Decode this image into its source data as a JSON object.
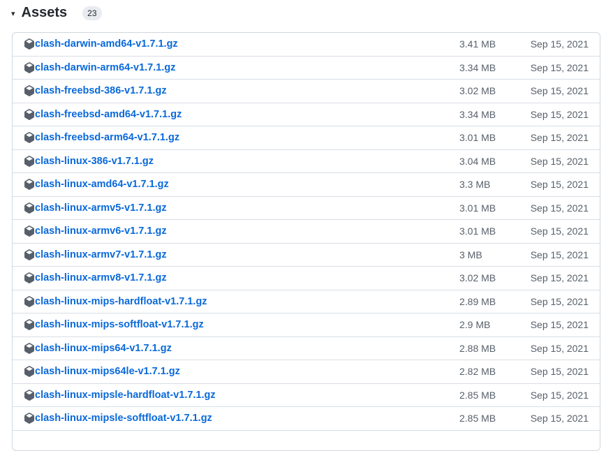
{
  "section": {
    "title": "Assets",
    "count": "23",
    "toggle_glyph": "▾"
  },
  "assets": [
    {
      "name": "clash-darwin-amd64-v1.7.1.gz",
      "size": "3.41 MB",
      "date": "Sep 15, 2021"
    },
    {
      "name": "clash-darwin-arm64-v1.7.1.gz",
      "size": "3.34 MB",
      "date": "Sep 15, 2021"
    },
    {
      "name": "clash-freebsd-386-v1.7.1.gz",
      "size": "3.02 MB",
      "date": "Sep 15, 2021"
    },
    {
      "name": "clash-freebsd-amd64-v1.7.1.gz",
      "size": "3.34 MB",
      "date": "Sep 15, 2021"
    },
    {
      "name": "clash-freebsd-arm64-v1.7.1.gz",
      "size": "3.01 MB",
      "date": "Sep 15, 2021"
    },
    {
      "name": "clash-linux-386-v1.7.1.gz",
      "size": "3.04 MB",
      "date": "Sep 15, 2021"
    },
    {
      "name": "clash-linux-amd64-v1.7.1.gz",
      "size": "3.3 MB",
      "date": "Sep 15, 2021"
    },
    {
      "name": "clash-linux-armv5-v1.7.1.gz",
      "size": "3.01 MB",
      "date": "Sep 15, 2021"
    },
    {
      "name": "clash-linux-armv6-v1.7.1.gz",
      "size": "3.01 MB",
      "date": "Sep 15, 2021"
    },
    {
      "name": "clash-linux-armv7-v1.7.1.gz",
      "size": "3 MB",
      "date": "Sep 15, 2021"
    },
    {
      "name": "clash-linux-armv8-v1.7.1.gz",
      "size": "3.02 MB",
      "date": "Sep 15, 2021"
    },
    {
      "name": "clash-linux-mips-hardfloat-v1.7.1.gz",
      "size": "2.89 MB",
      "date": "Sep 15, 2021"
    },
    {
      "name": "clash-linux-mips-softfloat-v1.7.1.gz",
      "size": "2.9 MB",
      "date": "Sep 15, 2021"
    },
    {
      "name": "clash-linux-mips64-v1.7.1.gz",
      "size": "2.88 MB",
      "date": "Sep 15, 2021"
    },
    {
      "name": "clash-linux-mips64le-v1.7.1.gz",
      "size": "2.82 MB",
      "date": "Sep 15, 2021"
    },
    {
      "name": "clash-linux-mipsle-hardfloat-v1.7.1.gz",
      "size": "2.85 MB",
      "date": "Sep 15, 2021"
    },
    {
      "name": "clash-linux-mipsle-softfloat-v1.7.1.gz",
      "size": "2.85 MB",
      "date": "Sep 15, 2021"
    }
  ],
  "icons": {
    "row_icon": "package-icon"
  },
  "colors": {
    "link": "#0969da",
    "muted": "#57606a",
    "border": "#d0d7de"
  }
}
